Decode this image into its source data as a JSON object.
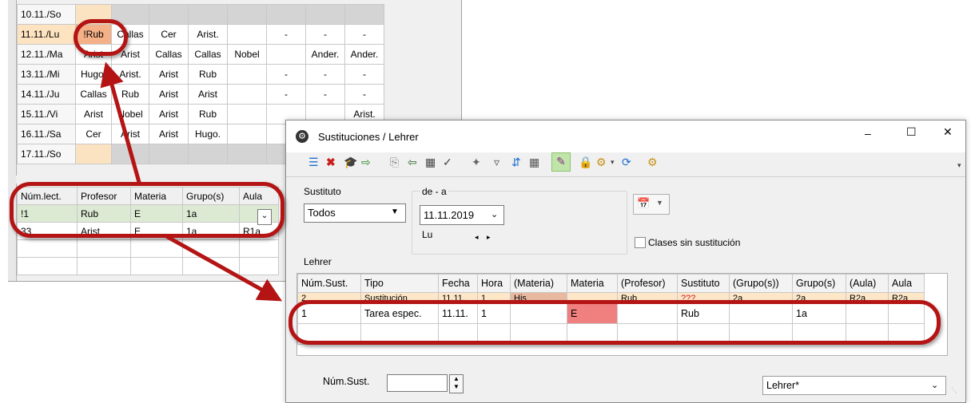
{
  "background_grid": {
    "rows": [
      {
        "day": "10.11./So",
        "cells": [
          "",
          "",
          "",
          "",
          "",
          "",
          "",
          ""
        ],
        "type": "sun"
      },
      {
        "day": "11.11./Lu",
        "cells": [
          "!Rub",
          "Callas",
          "Cer",
          "Arist.",
          "",
          "-",
          "-",
          "-"
        ],
        "type": "cur"
      },
      {
        "day": "12.11./Ma",
        "cells": [
          "Arist",
          "Arist",
          "Callas",
          "Callas",
          "Nobel",
          "",
          "Ander.",
          "Ander."
        ],
        "type": "norm"
      },
      {
        "day": "13.11./Mi",
        "cells": [
          "Hugo.",
          "Arist.",
          "Arist",
          "Rub",
          "",
          "-",
          "-",
          "-"
        ],
        "type": "norm"
      },
      {
        "day": "14.11./Ju",
        "cells": [
          "Callas",
          "Rub",
          "Arist",
          "Arist",
          "",
          "-",
          "-",
          "-"
        ],
        "type": "norm"
      },
      {
        "day": "15.11./Vi",
        "cells": [
          "Arist",
          "Nobel",
          "Arist",
          "Rub",
          "",
          "",
          "",
          "Arist."
        ],
        "type": "norm"
      },
      {
        "day": "16.11./Sa",
        "cells": [
          "Cer",
          "Arist",
          "Arist",
          "Hugo.",
          "",
          "",
          "",
          ""
        ],
        "type": "norm"
      },
      {
        "day": "17.11./So",
        "cells": [
          "",
          "",
          "",
          "",
          "",
          "",
          "",
          ""
        ],
        "type": "sun"
      }
    ]
  },
  "lower_table": {
    "headers": [
      "Núm.lect.",
      "Profesor",
      "Materia",
      "Grupo(s)",
      "Aula"
    ],
    "rows": [
      [
        "!1",
        "Rub",
        "E",
        "1a",
        ""
      ],
      [
        "33",
        "Arist",
        "E",
        "1a",
        "R1a"
      ]
    ]
  },
  "window": {
    "title": "Sustituciones / Lehrer",
    "controls": {
      "minimize": "–",
      "maximize": "☐",
      "close": "✕"
    }
  },
  "filters": {
    "sustituto_label": "Sustituto",
    "sustituto_value": "Todos",
    "range_label": "de - a",
    "date_value": "11.11.2019",
    "day_label": "Lu",
    "prev_next": "◂ ▸",
    "checkbox_label": "Clases sin sustitución",
    "section_label": "Lehrer"
  },
  "subs_table": {
    "headers": [
      "Núm.Sust.",
      "Tipo",
      "Fecha",
      "Hora",
      "(Materia)",
      "Materia",
      "(Profesor)",
      "Sustituto",
      "(Grupo(s))",
      "Grupo(s)",
      "(Aula)",
      "Aula"
    ],
    "rows": [
      [
        "2",
        "Sustitución",
        "11.11.",
        "1",
        "His",
        "",
        "Rub",
        "???",
        "2a",
        "2a",
        "R2a",
        "R2a"
      ],
      [
        "1",
        "Tarea espec.",
        "11.11.",
        "1",
        "",
        "E",
        "",
        "Rub",
        "",
        "1a",
        "",
        ""
      ]
    ]
  },
  "footer": {
    "num_sust_label": "Núm.Sust.",
    "num_sust_value": "",
    "view_select": "Lehrer*"
  },
  "colors": {
    "accent_red": "#b41414",
    "highlight_red": "#f08080",
    "orange": "#fcd9b0"
  }
}
